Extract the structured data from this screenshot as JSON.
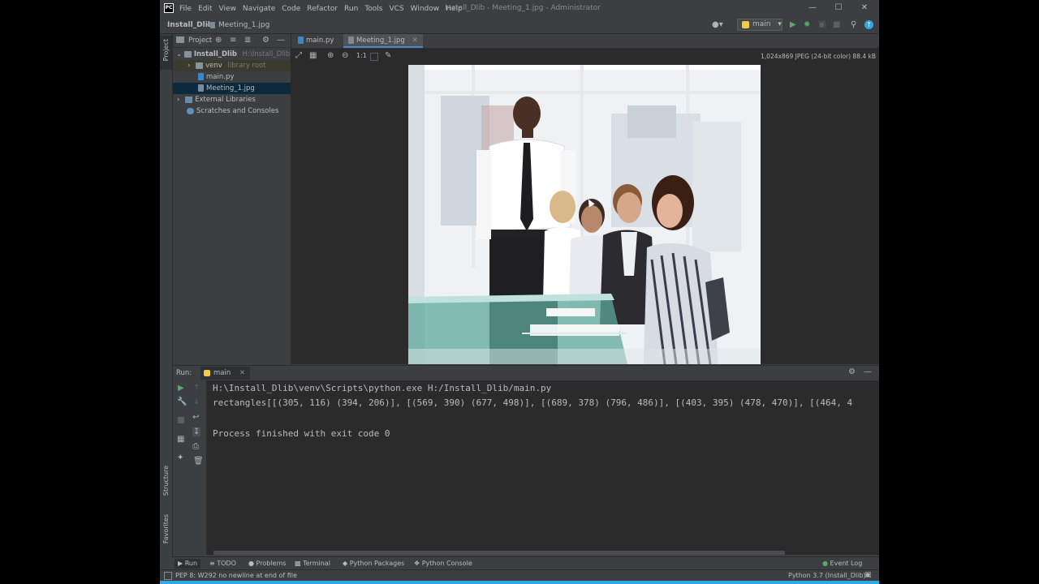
{
  "title_bar": {
    "menu": [
      "File",
      "Edit",
      "View",
      "Navigate",
      "Code",
      "Refactor",
      "Run",
      "Tools",
      "VCS",
      "Window",
      "Help"
    ],
    "window_title": "Install_Dlib - Meeting_1.jpg - Administrator",
    "logo_text": "PC"
  },
  "nav_bar": {
    "project": "Install_Dlib",
    "file": "Meeting_1.jpg",
    "run_config": "main"
  },
  "project_panel": {
    "title": "Project",
    "tree": [
      {
        "label": "Install_Dlib",
        "hint": "H:\\Install_Dlib"
      },
      {
        "label": "venv",
        "hint": "library root"
      },
      {
        "label": "main.py",
        "hint": ""
      },
      {
        "label": "Meeting_1.jpg",
        "hint": ""
      },
      {
        "label": "External Libraries",
        "hint": ""
      },
      {
        "label": "Scratches and Consoles",
        "hint": ""
      }
    ]
  },
  "side_stripe": {
    "project": "Project",
    "structure": "Structure",
    "favorites": "Favorites"
  },
  "editor": {
    "tabs": [
      {
        "label": "main.py",
        "active": false
      },
      {
        "label": "Meeting_1.jpg",
        "active": true
      }
    ],
    "image_info": "1,024x869 JPEG (24-bit color) 88.4 kB",
    "zoom_label": "1:1"
  },
  "run_panel": {
    "label": "Run:",
    "tab": "main",
    "console": [
      "H:\\Install_Dlib\\venv\\Scripts\\python.exe H:/Install_Dlib/main.py",
      "rectangles[[(305, 116) (394, 206)], [(569, 390) (677, 498)], [(689, 378) (796, 486)], [(403, 395) (478, 470)], [(464, 4",
      "",
      "Process finished with exit code 0"
    ]
  },
  "bottom_bar": {
    "tools": [
      "Run",
      "TODO",
      "Problems",
      "Terminal",
      "Python Packages",
      "Python Console"
    ],
    "event_log": "Event Log"
  },
  "status_bar": {
    "message": "PEP 8: W292 no newline at end of file",
    "interpreter": "Python 3.7 (Install_Dlib)"
  },
  "colors": {
    "accent": "#2ea8e6",
    "selection": "#0d293e",
    "editor_bg": "#2b2b2b",
    "panel_bg": "#3c3f41"
  }
}
